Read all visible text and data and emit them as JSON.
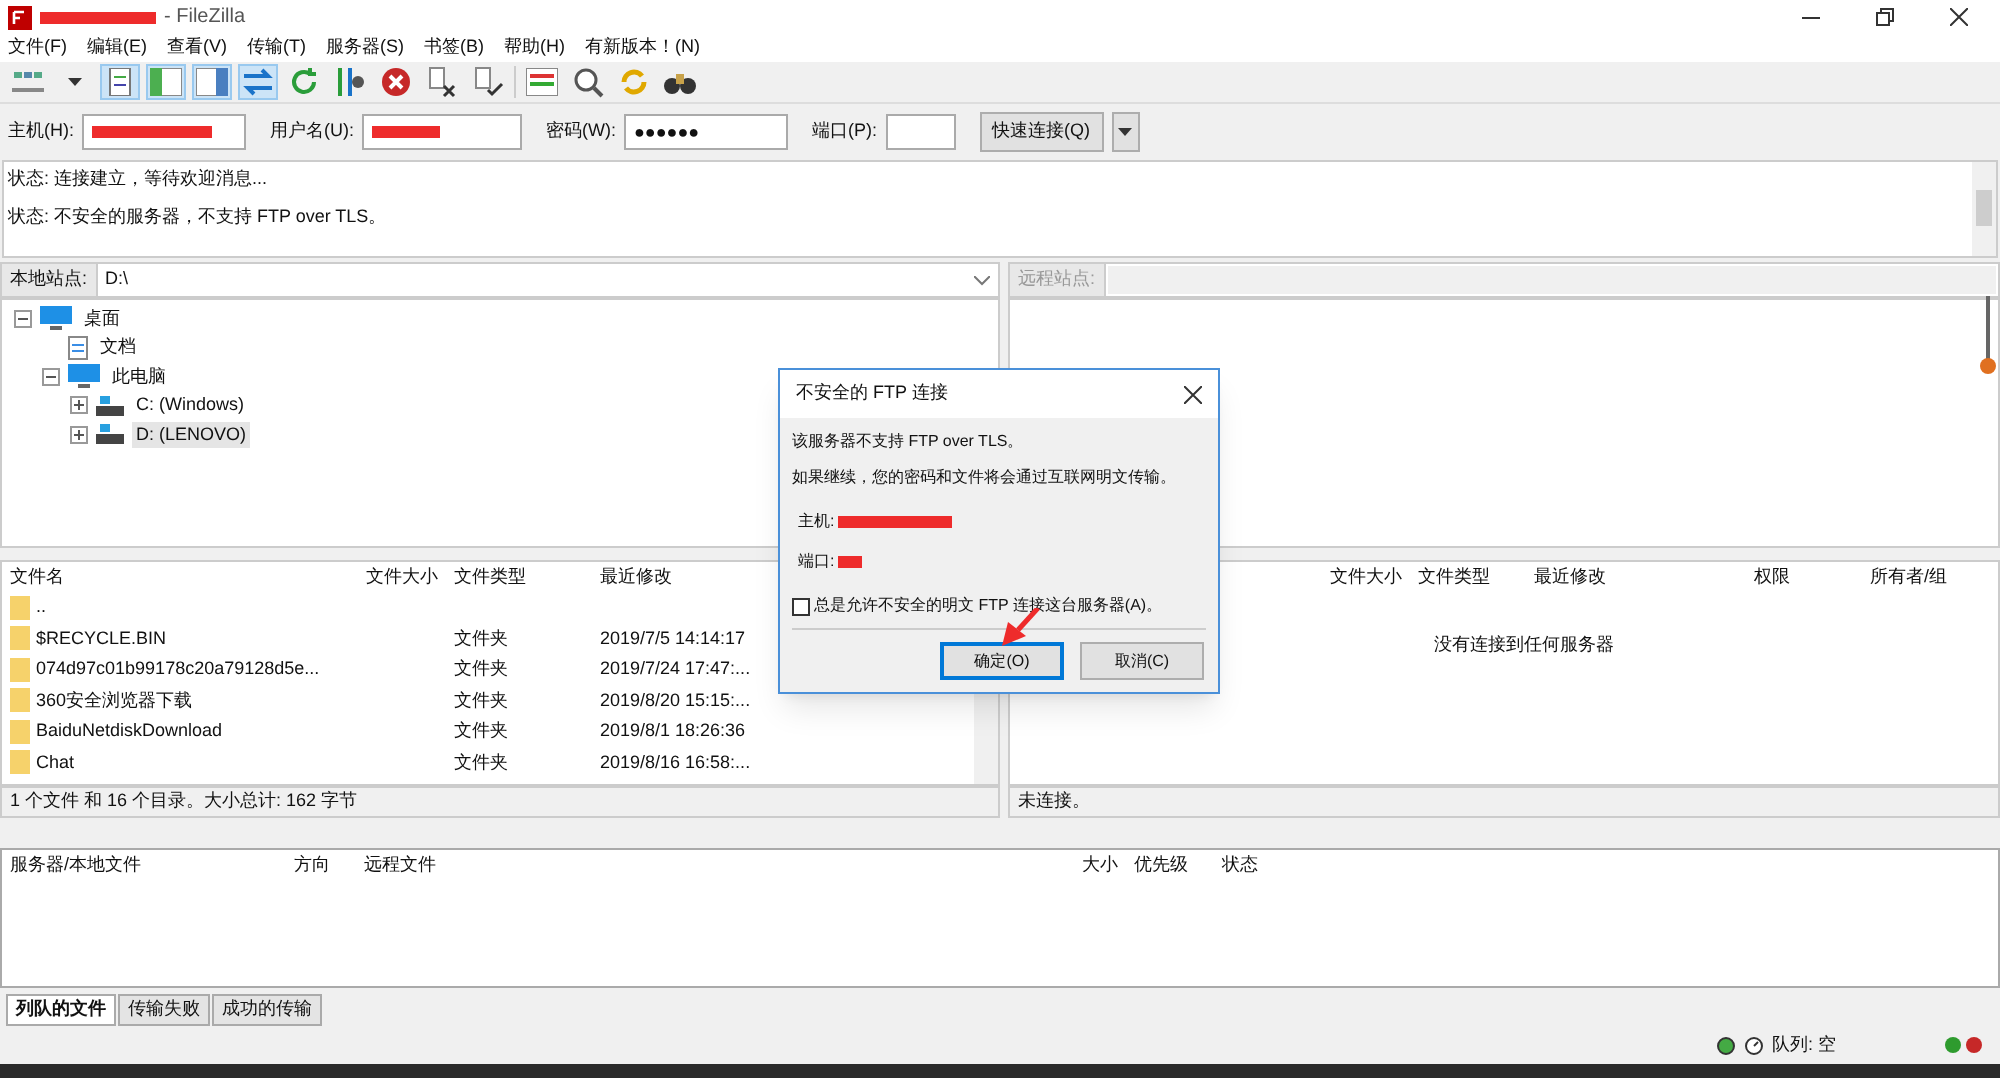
{
  "window": {
    "title": "- FileZilla"
  },
  "menu": [
    "文件(F)",
    "编辑(E)",
    "查看(V)",
    "传输(T)",
    "服务器(S)",
    "书签(B)",
    "帮助(H)",
    "有新版本！(N)"
  ],
  "quickconnect": {
    "host_label": "主机(H):",
    "user_label": "用户名(U):",
    "password_label": "密码(W):",
    "password": "●●●●●●",
    "port_label": "端口(P):",
    "button": "快速连接(Q)"
  },
  "log": [
    "状态:  连接建立，等待欢迎消息...",
    "状态:  不安全的服务器，不支持 FTP over TLS。"
  ],
  "local": {
    "site_label": "本地站点:",
    "path": "D:\\",
    "tree": [
      {
        "label": "桌面",
        "kind": "desktop",
        "expanded": true,
        "selected": false,
        "children": [
          {
            "label": "文档",
            "kind": "doc",
            "selected": false
          },
          {
            "label": "此电脑",
            "kind": "pc",
            "expanded": true,
            "selected": false,
            "children": [
              {
                "label": "C: (Windows)",
                "kind": "drive",
                "expanded": false,
                "selected": false
              },
              {
                "label": "D: (LENOVO)",
                "kind": "drive",
                "expanded": false,
                "selected": true
              }
            ]
          }
        ]
      }
    ],
    "columns": [
      "文件名",
      "文件大小",
      "文件类型",
      "最近修改"
    ],
    "rows": [
      {
        "name": "..",
        "type": "",
        "modified": ""
      },
      {
        "name": "$RECYCLE.BIN",
        "type": "文件夹",
        "modified": "2019/7/5 14:14:17"
      },
      {
        "name": "074d97c01b99178c20a79128d5e...",
        "type": "文件夹",
        "modified": "2019/7/24 17:47:..."
      },
      {
        "name": "360安全浏览器下载",
        "type": "文件夹",
        "modified": "2019/8/20 15:15:..."
      },
      {
        "name": "BaiduNetdiskDownload",
        "type": "文件夹",
        "modified": "2019/8/1 18:26:36"
      },
      {
        "name": "Chat",
        "type": "文件夹",
        "modified": "2019/8/16 16:58:..."
      }
    ],
    "status": "1 个文件 和 16 个目录。大小总计: 162 字节"
  },
  "remote": {
    "site_label": "远程站点:",
    "columns": [
      "文件大小",
      "文件类型",
      "最近修改",
      "权限",
      "所有者/组"
    ],
    "empty_message": "没有连接到任何服务器",
    "status": "未连接。"
  },
  "queue": {
    "columns": [
      "服务器/本地文件",
      "方向",
      "远程文件",
      "大小",
      "优先级",
      "状态"
    ],
    "tabs": [
      {
        "label": "列队的文件",
        "selected": true
      },
      {
        "label": "传输失败",
        "selected": false
      },
      {
        "label": "成功的传输",
        "selected": false
      }
    ],
    "status": "队列: 空"
  },
  "dialog": {
    "title": "不安全的 FTP 连接",
    "lines": [
      "该服务器不支持 FTP over TLS。",
      "如果继续，您的密码和文件将会通过互联网明文传输。"
    ],
    "host_label": "主机:",
    "port_label": "端口:",
    "checkbox": {
      "label": "总是允许不安全的明文 FTP 连接这台服务器(A)。",
      "checked": false
    },
    "ok": "确定(O)",
    "cancel": "取消(C)"
  }
}
